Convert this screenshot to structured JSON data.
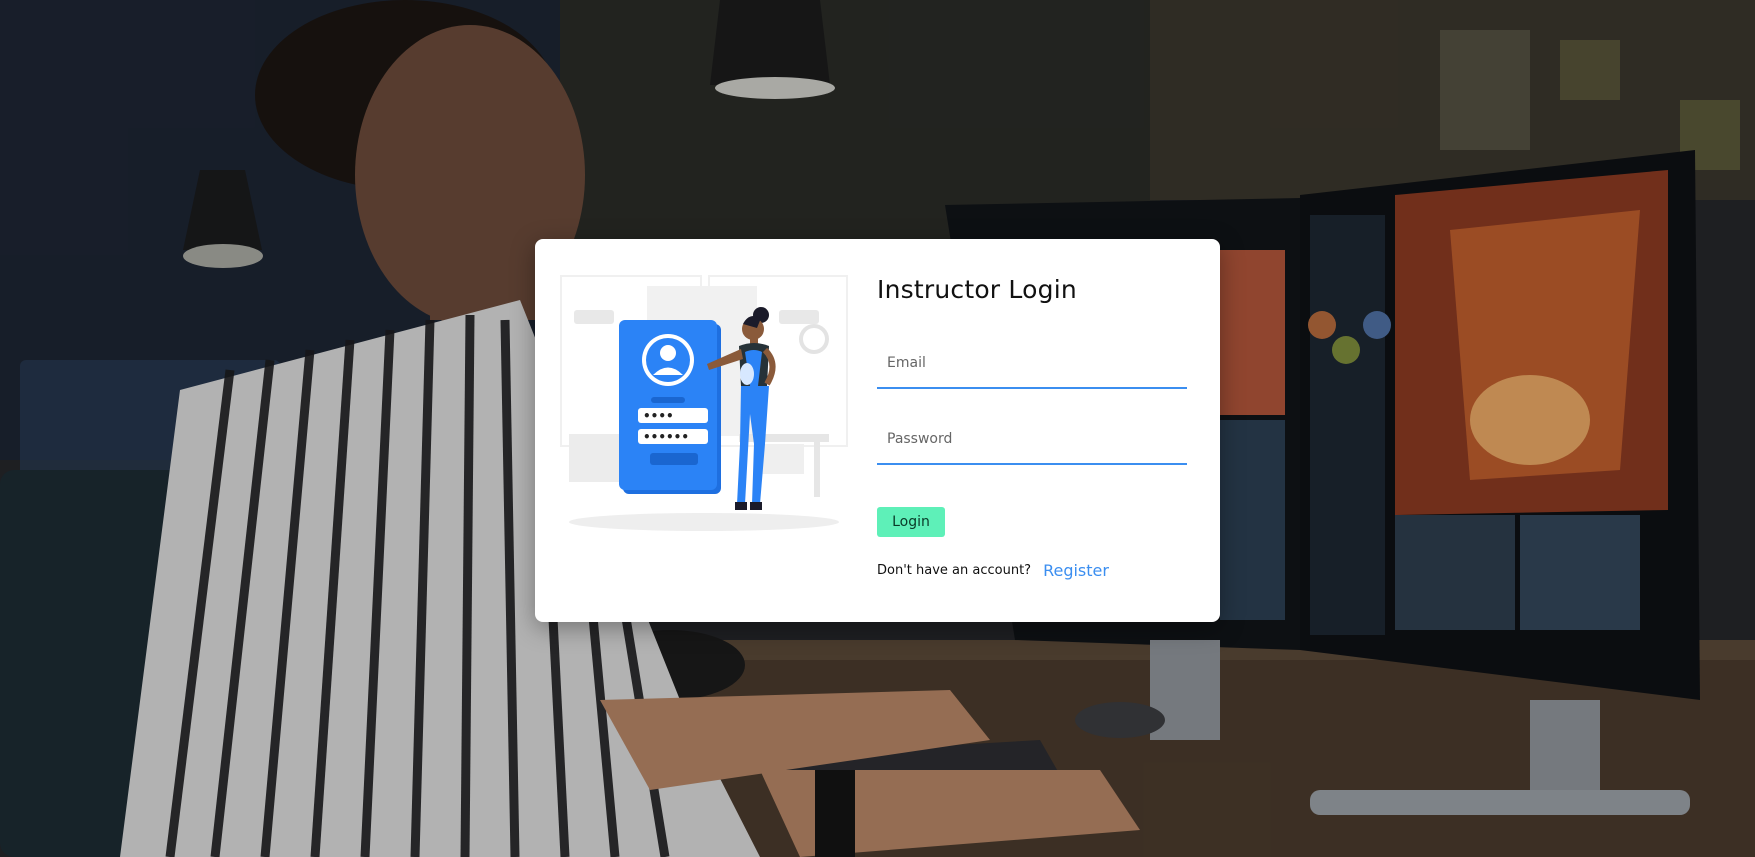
{
  "login_card": {
    "title": "Instructor Login",
    "email_placeholder": "Email",
    "password_placeholder": "Password",
    "login_label": "Login",
    "no_account_text": "Don't have an account?",
    "register_label": "Register"
  },
  "illustration": {
    "masked_short": "••••",
    "masked_long": "••••••"
  },
  "colors": {
    "accent_blue": "#3b8ef0",
    "login_button": "#5ef0b8",
    "card_bg": "#ffffff"
  }
}
